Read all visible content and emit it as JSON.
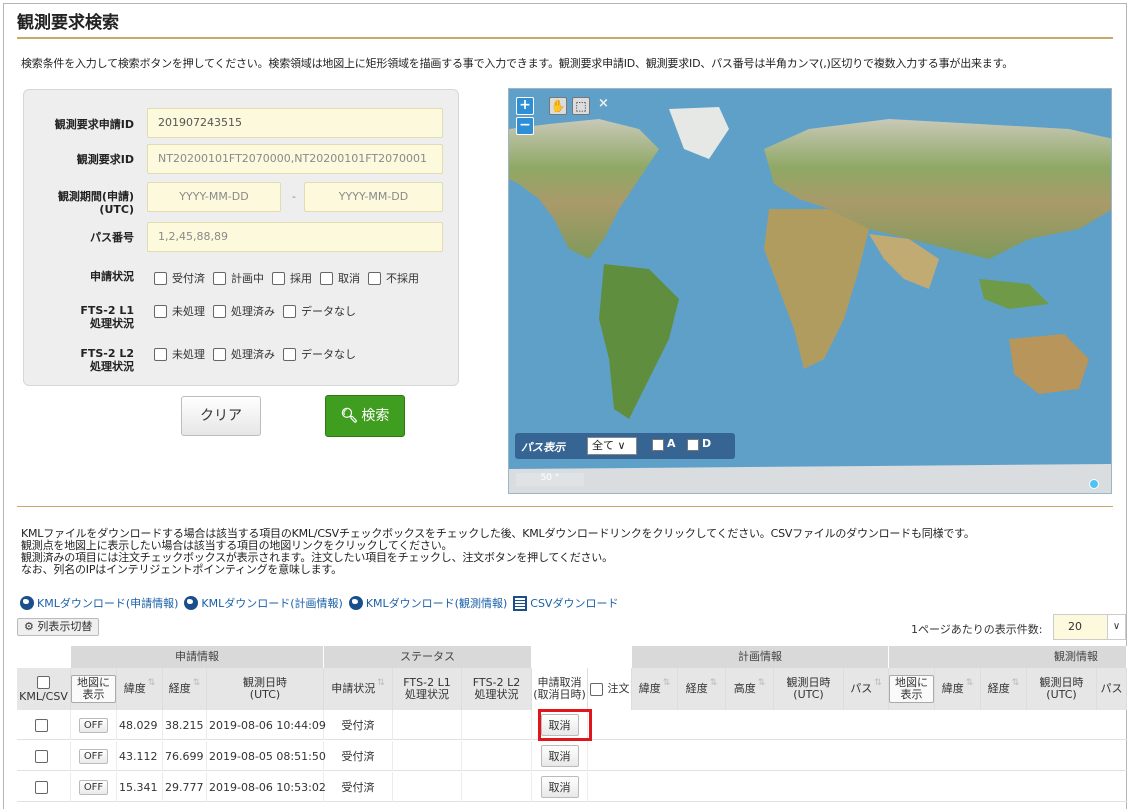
{
  "page": {
    "title": "観測要求検索",
    "instruction": "検索条件を入力して検索ボタンを押してください。検索領域は地図上に矩形領域を描画する事で入力できます。観測要求申請ID、観測要求ID、パス番号は半角カンマ(,)区切りで複数入力する事が出来ます。"
  },
  "form": {
    "request_app_id_label": "観測要求申請ID",
    "request_app_id_value": "201907243515",
    "request_id_label": "観測要求ID",
    "request_id_placeholder": "NT20200101FT2070000,NT20200101FT2070001",
    "period_label": "観測期間(申請)",
    "period_label_sub": "(UTC)",
    "period_from_placeholder": "YYYY-MM-DD",
    "period_sep": "-",
    "period_to_placeholder": "YYYY-MM-DD",
    "path_label": "パス番号",
    "path_placeholder": "1,2,45,88,89",
    "status_label": "申請状況",
    "status_options": [
      "受付済",
      "計画中",
      "採用",
      "取消",
      "不採用"
    ],
    "fts_l1_label": "FTS-2 L1",
    "fts_l1_label_sub": "処理状況",
    "fts_l2_label": "FTS-2 L2",
    "fts_l2_label_sub": "処理状況",
    "proc_options": [
      "未処理",
      "処理済み",
      "データなし"
    ],
    "clear_button": "クリア",
    "search_button": "検索"
  },
  "map": {
    "zoom_in": "+",
    "zoom_out": "−",
    "close_symbol": "×",
    "path_display_label": "パス表示",
    "path_display_value": "全て",
    "path_a": "A",
    "path_d": "D",
    "scale": "50 °",
    "ocean_color": "#5fa0c8",
    "land_color": "#7f9a5a"
  },
  "notes": [
    "KMLファイルをダウンロードする場合は該当する項目のKML/CSVチェックボックスをチェックした後、KMLダウンロードリンクをクリックしてください。CSVファイルのダウンロードも同様です。",
    "観測点を地図上に表示したい場合は該当する項目の地図リンクをクリックしてください。",
    "観測済みの項目には注文チェックボックスが表示されます。注文したい項目をチェックし、注文ボタンを押してください。",
    "なお、列名のIPはインテリジェントポインティングを意味します。"
  ],
  "downloads": {
    "kml_application": "KMLダウンロード(申請情報)",
    "kml_plan": "KMLダウンロード(計画情報)",
    "kml_observation": "KMLダウンロード(観測情報)",
    "csv": "CSVダウンロード"
  },
  "table_controls": {
    "column_toggle": "列表示切替",
    "per_page_label": "1ページあたりの表示件数:",
    "per_page_value": "20"
  },
  "table": {
    "groups": {
      "application": "申請情報",
      "status": "ステータス",
      "plan": "計画情報",
      "observation": "観測情報"
    },
    "headers": {
      "kmlcsv": "KML/CSV",
      "map": "地図に表示",
      "lat": "緯度",
      "lon": "経度",
      "obs_datetime": "観測日時",
      "utc": "(UTC)",
      "app_status": "申請状況",
      "fts_l1": "FTS-2 L1",
      "fts_l1_sub": "処理状況",
      "fts_l2": "FTS-2 L2",
      "fts_l2_sub": "処理状況",
      "cancel": "申請取消",
      "cancel_sub": "(取消日時)",
      "order": "注文",
      "plan_lat": "緯度",
      "plan_lon": "経度",
      "plan_alt": "高度",
      "plan_datetime": "観測日時",
      "plan_utc": "(UTC)",
      "plan_path": "パス",
      "obs_map": "地図に表示",
      "obs_lat": "緯度",
      "obs_lon": "経度",
      "obs_dt": "観測日時",
      "obs_utc": "(UTC)",
      "obs_path": "パス"
    },
    "rows": [
      {
        "off": "OFF",
        "lat": "48.029",
        "lon": "38.215",
        "datetime": "2019-08-06 10:44:09",
        "status": "受付済",
        "cancel": "取消"
      },
      {
        "off": "OFF",
        "lat": "43.112",
        "lon": "76.699",
        "datetime": "2019-08-05 08:51:50",
        "status": "受付済",
        "cancel": "取消"
      },
      {
        "off": "OFF",
        "lat": "15.341",
        "lon": "29.777",
        "datetime": "2019-08-06 10:53:02",
        "status": "受付済",
        "cancel": "取消"
      }
    ]
  }
}
